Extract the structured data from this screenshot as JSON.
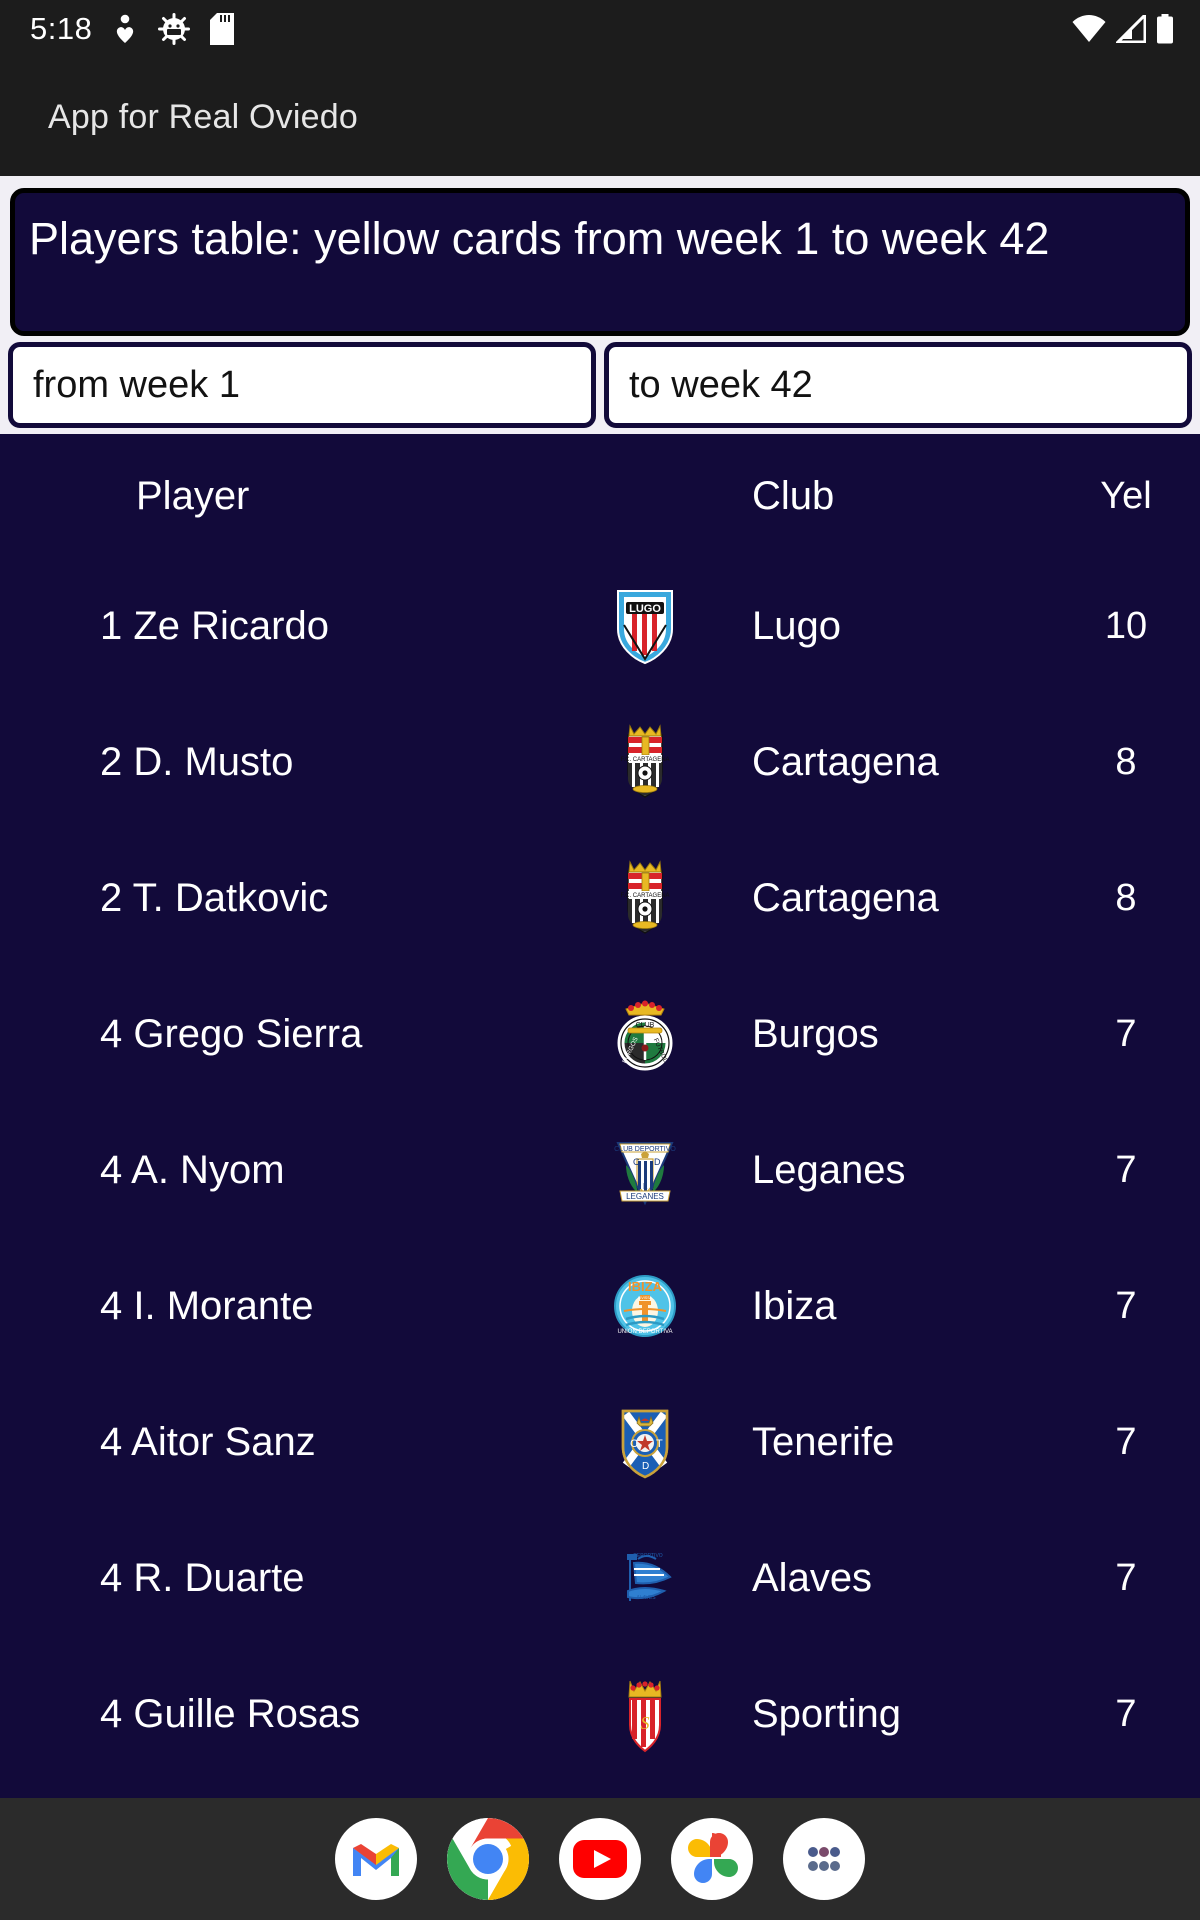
{
  "statusbar": {
    "time": "5:18",
    "icons": [
      "person-heart-icon",
      "android-debug-icon",
      "sd-card-icon",
      "wifi-icon",
      "cellular-signal-icon",
      "battery-icon"
    ]
  },
  "appbar": {
    "title": "App for Real Oviedo"
  },
  "banner": {
    "text": "Players table: yellow cards from week 1 to week 42"
  },
  "filters": {
    "from": {
      "value": "from week 1",
      "placeholder": "from week"
    },
    "to": {
      "value": "to week 42",
      "placeholder": "to week"
    }
  },
  "table": {
    "columns": {
      "player": "Player",
      "club": "Club",
      "yellow": "Yel"
    },
    "rows": [
      {
        "player": "1 Ze Ricardo",
        "crest": "lugo-crest",
        "club": "Lugo",
        "yellow": "10"
      },
      {
        "player": "2 D. Musto",
        "crest": "cartagena-crest",
        "club": "Cartagena",
        "yellow": "8"
      },
      {
        "player": "2 T. Datkovic",
        "crest": "cartagena-crest",
        "club": "Cartagena",
        "yellow": "8"
      },
      {
        "player": "4 Grego Sierra",
        "crest": "burgos-crest",
        "club": "Burgos",
        "yellow": "7"
      },
      {
        "player": "4 A. Nyom",
        "crest": "leganes-crest",
        "club": "Leganes",
        "yellow": "7"
      },
      {
        "player": "4 I. Morante",
        "crest": "ibiza-crest",
        "club": "Ibiza",
        "yellow": "7"
      },
      {
        "player": "4 Aitor Sanz",
        "crest": "tenerife-crest",
        "club": "Tenerife",
        "yellow": "7"
      },
      {
        "player": "4 R. Duarte",
        "crest": "alaves-crest",
        "club": "Alaves",
        "yellow": "7"
      },
      {
        "player": "4 Guille Rosas",
        "crest": "sporting-crest",
        "club": "Sporting",
        "yellow": "7"
      }
    ]
  },
  "dock": {
    "items": [
      "gmail-icon",
      "chrome-icon",
      "youtube-icon",
      "google-photos-icon",
      "app-drawer-icon"
    ]
  },
  "colors": {
    "background": "#120a3a",
    "system_bar": "#1c1c1c",
    "banner_border": "#000000",
    "input_background": "#ffffff",
    "surface": "#f1eff5",
    "text": "#ffffff"
  }
}
